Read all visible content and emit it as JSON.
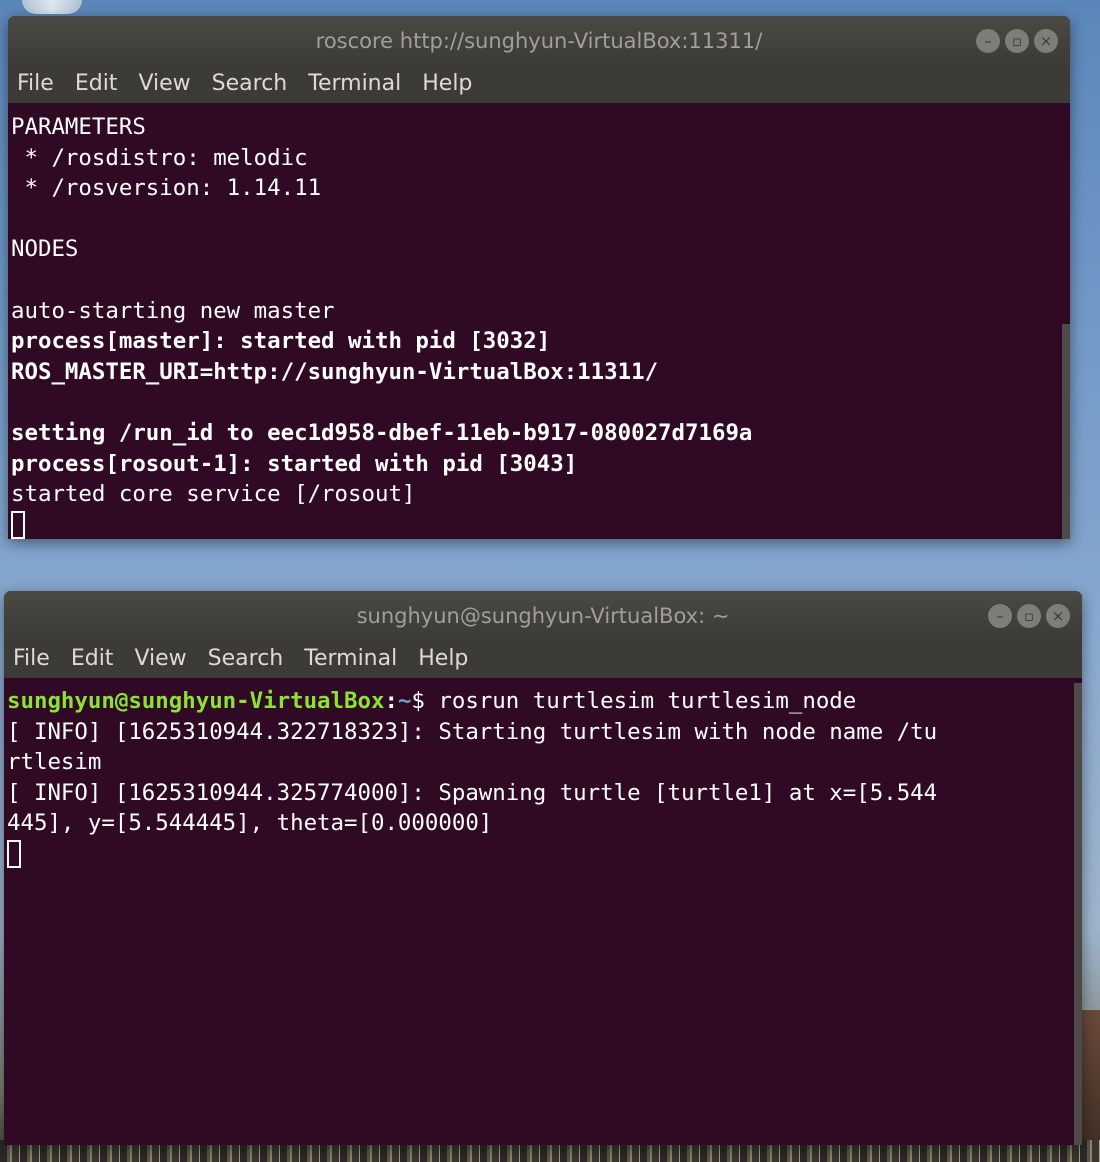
{
  "windows": [
    {
      "title": "roscore http://sunghyun-VirtualBox:11311/",
      "menu": [
        "File",
        "Edit",
        "View",
        "Search",
        "Terminal",
        "Help"
      ],
      "lines": [
        "PARAMETERS",
        " * /rosdistro: melodic",
        " * /rosversion: 1.14.11",
        "",
        "NODES",
        "",
        "auto-starting new master",
        "process[master]: started with pid [3032]",
        "ROS_MASTER_URI=http://sunghyun-VirtualBox:11311/",
        "",
        "setting /run_id to eec1d958-dbef-11eb-b917-080027d7169a",
        "process[rosout-1]: started with pid [3043]",
        "started core service [/rosout]"
      ]
    },
    {
      "title": "sunghyun@sunghyun-VirtualBox: ~",
      "menu": [
        "File",
        "Edit",
        "View",
        "Search",
        "Terminal",
        "Help"
      ],
      "prompt_user": "sunghyun@sunghyun-VirtualBox",
      "prompt_sep": ":",
      "prompt_path": "~",
      "prompt_cmd": "$ rosrun turtlesim turtlesim_node",
      "lines": [
        "[ INFO] [1625310944.322718323]: Starting turtlesim with node name /tu",
        "rtlesim",
        "[ INFO] [1625310944.325774000]: Spawning turtle [turtle1] at x=[5.544",
        "445], y=[5.544445], theta=[0.000000]"
      ]
    }
  ],
  "colors": {
    "terminal_bg": "#300a24",
    "titlebar": "#3c3b37",
    "prompt_user": "#8ae234",
    "prompt_path": "#729fcf"
  }
}
